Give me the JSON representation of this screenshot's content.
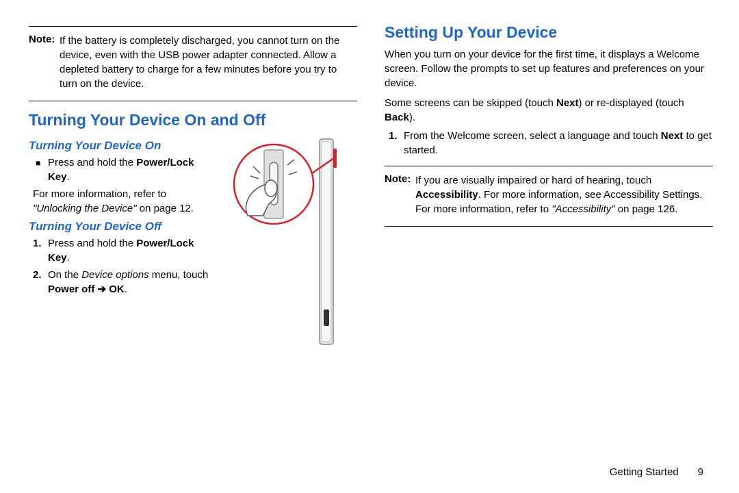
{
  "left": {
    "note": {
      "label": "Note:",
      "text": "If the battery is completely discharged, you cannot turn on the device, even with the USB power adapter connected. Allow a depleted battery to charge for a few minutes before you try to turn on the device."
    },
    "h2": "Turning Your Device On and Off",
    "on": {
      "h3": "Turning Your Device On",
      "bullet_pre": "Press and hold the ",
      "bullet_bold": "Power/Lock Key",
      "bullet_post": ".",
      "ref_pre": "For more information, refer to ",
      "ref_ital": "\"Unlocking the Device\"",
      "ref_post": " on page 12."
    },
    "off": {
      "h3": "Turning Your Device Off",
      "s1_num": "1.",
      "s1_pre": "Press and hold the ",
      "s1_bold": "Power/Lock Key",
      "s1_post": ".",
      "s2_num": "2.",
      "s2_pre": "On the ",
      "s2_ital": "Device options",
      "s2_mid": " menu, touch ",
      "s2_bold1": "Power off",
      "s2_arrow": " ➔ ",
      "s2_bold2": "OK",
      "s2_post": "."
    }
  },
  "right": {
    "h2": "Setting Up Your Device",
    "p1": "When you turn on your device for the first time, it displays a Welcome screen. Follow the prompts to set up features and preferences on your device.",
    "p2_pre": "Some screens can be skipped (touch ",
    "p2_b1": "Next",
    "p2_mid": ") or re-displayed (touch ",
    "p2_b2": "Back",
    "p2_post": ").",
    "s1_num": "1.",
    "s1_pre": "From the Welcome screen, select a language and touch ",
    "s1_bold": "Next",
    "s1_post": " to get started.",
    "note": {
      "label": "Note:",
      "l1_pre": "If you are visually impaired or hard of hearing, touch ",
      "l1_b": "Accessibility",
      "l1_mid": ". For more information, see Accessibility Settings. For more information, refer to ",
      "l1_i": "\"Accessibility\"",
      "l1_post": " on page 126."
    }
  },
  "footer": {
    "section": "Getting Started",
    "page": "9"
  }
}
